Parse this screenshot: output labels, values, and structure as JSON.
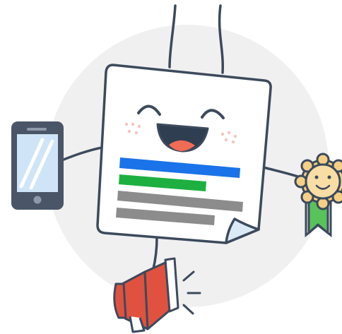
{
  "illustration": {
    "subject": "happy-document-mascot",
    "colors": {
      "outline": "#3c4a5c",
      "background_circle": "#f0f0f0",
      "paper": "#ffffff",
      "page_curl": "#dbe9f7",
      "bar_blue": "#1a73e8",
      "bar_green": "#1db040",
      "bar_gray": "#8c8c8c",
      "mouth": "#2f3e50",
      "tongue": "#f26b55",
      "cheeks": "#f6c5bd",
      "phone_body": "#4a5667",
      "phone_screen": "#cfe4f7",
      "phone_glare": "#ffffff",
      "megaphone_red": "#e0523f",
      "megaphone_white": "#ffffff",
      "flower_petals": "#f5cf86",
      "flower_face": "#f8dea4",
      "ribbon_green": "#58c25b"
    },
    "icons": [
      "smartphone-icon",
      "megaphone-icon",
      "award-ribbon-icon",
      "happy-face-icon"
    ]
  }
}
